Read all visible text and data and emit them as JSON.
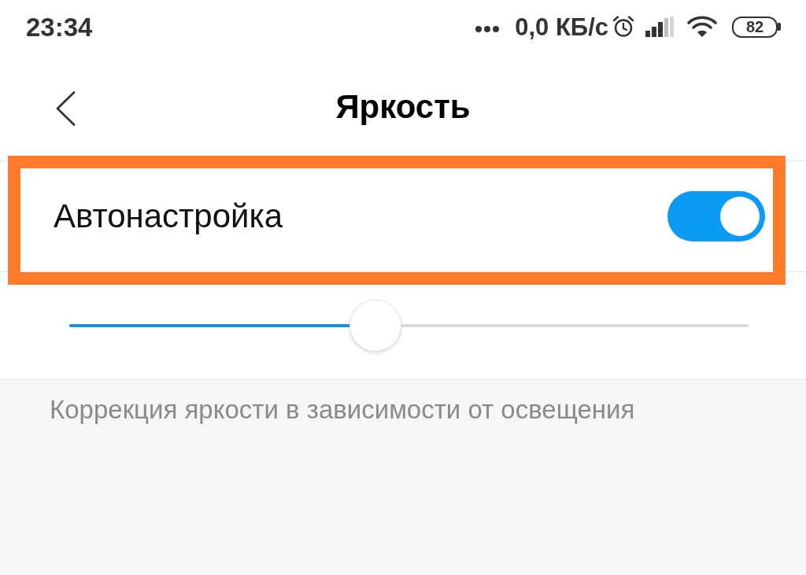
{
  "status_bar": {
    "time": "23:34",
    "network_speed": "0,0 КБ/с",
    "battery": "82"
  },
  "header": {
    "title": "Яркость"
  },
  "auto_brightness": {
    "label": "Автонастройка",
    "on": true,
    "highlighted": true
  },
  "brightness_slider": {
    "level": 0.45
  },
  "description": "Коррекция яркости в зависимости от освещения"
}
